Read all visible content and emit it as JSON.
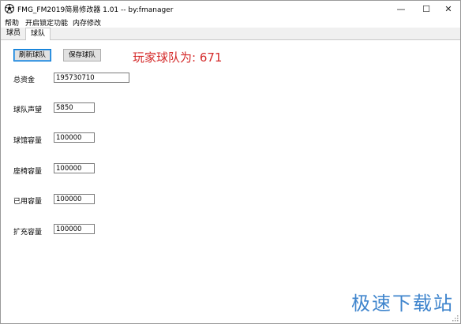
{
  "window": {
    "title": "FMG_FM2019简易修改器 1.01 -- by:fmanager",
    "controls": {
      "minimize": "—",
      "maximize": "☐",
      "close": "✕"
    }
  },
  "menu": [
    "帮助",
    "开启锁定功能",
    "内存修改"
  ],
  "tabs": [
    {
      "label": "球员",
      "active": false
    },
    {
      "label": "球队",
      "active": true
    }
  ],
  "toolbar": {
    "refresh_label": "刷新球队",
    "save_label": "保存球队"
  },
  "headline": "玩家球队为: 671",
  "fields": [
    {
      "label": "总资金",
      "value": "195730710"
    },
    {
      "label": "球队声望",
      "value": "5850"
    },
    {
      "label": "球馆容量",
      "value": "100000"
    },
    {
      "label": "座椅容量",
      "value": "100000"
    },
    {
      "label": "已用容量",
      "value": "100000"
    },
    {
      "label": "扩充容量",
      "value": "100000"
    }
  ],
  "watermark": "极速下载站",
  "colors": {
    "headline": "#d42a2a",
    "watermark": "#2b78c8",
    "accent": "#0078d7"
  }
}
